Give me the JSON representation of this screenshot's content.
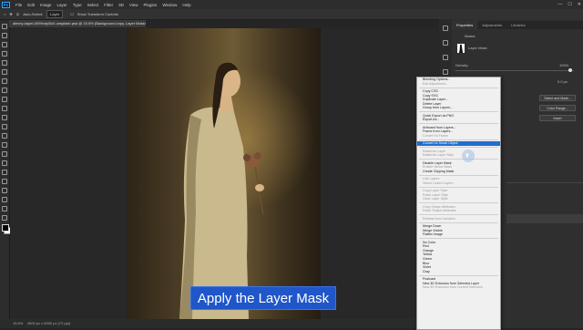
{
  "menu": {
    "app_badge": "Ps",
    "items": [
      "File",
      "Edit",
      "Image",
      "Layer",
      "Type",
      "Select",
      "Filter",
      "3D",
      "View",
      "Plugins",
      "Window",
      "Help"
    ]
  },
  "options_bar": {
    "auto_select": "Auto-Select:",
    "auto_select_value": "Layer",
    "show_transform": "Show Transform Controls"
  },
  "document_tab": {
    "title": "alexey-kapel-4099vdyl3c0-unsplash.psd @ 15.5% (Background copy, Layer Mask/8) *"
  },
  "status_bar": {
    "zoom": "15.5%",
    "info": "4000 px x 6000 px (72 ppi)"
  },
  "panels": {
    "tabs": [
      "Properties",
      "Adjustments",
      "Libraries"
    ],
    "masks_label": "Masks",
    "layer_mask_label": "Layer Mask",
    "density_label": "Density:",
    "density_value": "100%",
    "feather_label": "Feather:",
    "feather_value": "0.0 px",
    "select_and_mask": "Select and Mask...",
    "color_range": "Color Range...",
    "invert": "Invert"
  },
  "context_menu": {
    "items": [
      {
        "label": "Blending Options...",
        "state": "normal"
      },
      {
        "label": "Edit Adjustment...",
        "state": "disabled"
      },
      {
        "sep": true
      },
      {
        "label": "Copy CSS",
        "state": "normal"
      },
      {
        "label": "Copy SVG",
        "state": "normal"
      },
      {
        "label": "Duplicate Layer...",
        "state": "normal"
      },
      {
        "label": "Delete Layer",
        "state": "normal"
      },
      {
        "label": "Group from Layers...",
        "state": "normal"
      },
      {
        "sep": true
      },
      {
        "label": "Quick Export as PNG",
        "state": "normal"
      },
      {
        "label": "Export As...",
        "state": "normal"
      },
      {
        "sep": true
      },
      {
        "label": "Artboard from Layers...",
        "state": "normal"
      },
      {
        "label": "Frame from Layers...",
        "state": "normal"
      },
      {
        "label": "Convert to Frame",
        "state": "disabled"
      },
      {
        "sep": true
      },
      {
        "label": "Convert to Smart Object",
        "state": "highlighted"
      },
      {
        "sep": true
      },
      {
        "label": "Rasterize Layer",
        "state": "disabled"
      },
      {
        "label": "Rasterize Layer Style",
        "state": "disabled"
      },
      {
        "sep": true
      },
      {
        "label": "Disable Layer Mask",
        "state": "normal"
      },
      {
        "label": "Enable Vector Mask",
        "state": "disabled"
      },
      {
        "label": "Create Clipping Mask",
        "state": "normal"
      },
      {
        "sep": true
      },
      {
        "label": "Link Layers",
        "state": "disabled"
      },
      {
        "label": "Select Linked Layers",
        "state": "disabled"
      },
      {
        "sep": true
      },
      {
        "label": "Copy Layer Style",
        "state": "disabled"
      },
      {
        "label": "Paste Layer Style",
        "state": "disabled"
      },
      {
        "label": "Clear Layer Style",
        "state": "disabled"
      },
      {
        "sep": true
      },
      {
        "label": "Copy Shape Attributes",
        "state": "disabled"
      },
      {
        "label": "Paste Shape Attributes",
        "state": "disabled"
      },
      {
        "sep": true
      },
      {
        "label": "Release from Isolation",
        "state": "disabled"
      },
      {
        "sep": true
      },
      {
        "label": "Merge Down",
        "state": "normal"
      },
      {
        "label": "Merge Visible",
        "state": "normal"
      },
      {
        "label": "Flatten Image",
        "state": "normal"
      },
      {
        "sep": true
      },
      {
        "label": "No Color",
        "state": "normal"
      },
      {
        "label": "Red",
        "state": "normal"
      },
      {
        "label": "Orange",
        "state": "normal"
      },
      {
        "label": "Yellow",
        "state": "normal"
      },
      {
        "label": "Green",
        "state": "normal"
      },
      {
        "label": "Blue",
        "state": "normal"
      },
      {
        "label": "Violet",
        "state": "normal"
      },
      {
        "label": "Gray",
        "state": "normal"
      },
      {
        "sep": true
      },
      {
        "label": "Postcard",
        "state": "normal"
      },
      {
        "label": "New 3D Extrusion from Selected Layer",
        "state": "normal"
      },
      {
        "label": "New 3D Extrusion from Current Selection",
        "state": "disabled"
      }
    ]
  },
  "caption": {
    "text": "Apply the Layer Mask"
  },
  "colors": {
    "highlight": "#1f6fd1",
    "caption_bg": "#1f56c9"
  }
}
